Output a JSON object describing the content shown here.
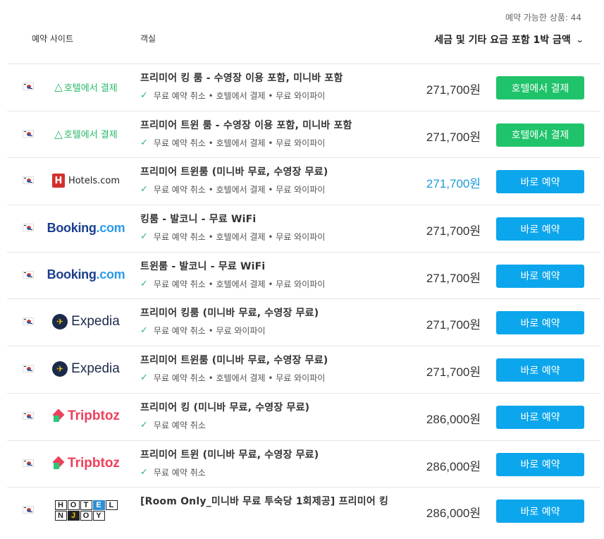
{
  "available_text": "예약 가능한 상품: 44",
  "header": {
    "site_col": "예약 사이트",
    "room_col": "객실",
    "price_col": "세금 및 기타 요금 포함 1박 금액",
    "sort_icon": "chevron-down-icon"
  },
  "colors": {
    "green_button": "#1fc36a",
    "blue_button": "#0ca6ec",
    "highlight_price": "#1e9bd7"
  },
  "offers": [
    {
      "provider": "호텔에서 결제",
      "logo": "hotel-pay",
      "title": "프리미어 킹 룸 - 수영장 이용 포함, 미니바 포함",
      "features": "무료 예약 취소 • 호텔에서 결제 • 무료 와이파이",
      "price": "271,700원",
      "button": "호텔에서 결제",
      "button_style": "green",
      "price_highlight": false
    },
    {
      "provider": "호텔에서 결제",
      "logo": "hotel-pay",
      "title": "프리미어 트윈 룸 - 수영장 이용 포함, 미니바 포함",
      "features": "무료 예약 취소 • 호텔에서 결제 • 무료 와이파이",
      "price": "271,700원",
      "button": "호텔에서 결제",
      "button_style": "green",
      "price_highlight": false
    },
    {
      "provider": "Hotels.com",
      "logo": "hotelscom",
      "title": "프리미어 트윈룸 (미니바 무료, 수영장 무료)",
      "features": "무료 예약 취소 • 호텔에서 결제 • 무료 와이파이",
      "price": "271,700원",
      "button": "바로 예약",
      "button_style": "blue",
      "price_highlight": true
    },
    {
      "provider": "Booking",
      "provider_suffix": ".com",
      "logo": "booking",
      "title": "킹룸 - 발코니 - 무료 WiFi",
      "features": "무료 예약 취소 • 호텔에서 결제 • 무료 와이파이",
      "price": "271,700원",
      "button": "바로 예약",
      "button_style": "blue",
      "price_highlight": false
    },
    {
      "provider": "Booking",
      "provider_suffix": ".com",
      "logo": "booking",
      "title": "트윈룸 - 발코니 - 무료 WiFi",
      "features": "무료 예약 취소 • 호텔에서 결제 • 무료 와이파이",
      "price": "271,700원",
      "button": "바로 예약",
      "button_style": "blue",
      "price_highlight": false
    },
    {
      "provider": "Expedia",
      "logo": "expedia",
      "title": "프리미어 킹룸 (미니바 무료, 수영장 무료)",
      "features": "무료 예약 취소 • 무료 와이파이",
      "price": "271,700원",
      "button": "바로 예약",
      "button_style": "blue",
      "price_highlight": false
    },
    {
      "provider": "Expedia",
      "logo": "expedia",
      "title": "프리미어 트윈룸 (미니바 무료, 수영장 무료)",
      "features": "무료 예약 취소 • 호텔에서 결제 • 무료 와이파이",
      "price": "271,700원",
      "button": "바로 예약",
      "button_style": "blue",
      "price_highlight": false
    },
    {
      "provider": "Tripbtoz",
      "logo": "tripbtoz",
      "title": "프리미어 킹 (미니바 무료, 수영장 무료)",
      "features": "무료 예약 취소",
      "price": "286,000원",
      "button": "바로 예약",
      "button_style": "blue",
      "price_highlight": false
    },
    {
      "provider": "Tripbtoz",
      "logo": "tripbtoz",
      "title": "프리미어 트윈 (미니바 무료, 수영장 무료)",
      "features": "무료 예약 취소",
      "price": "286,000원",
      "button": "바로 예약",
      "button_style": "blue",
      "price_highlight": false
    },
    {
      "provider": "HOTELNJOY",
      "logo": "hotelnjoy",
      "title": "[Room Only_미니바 무료 투숙당 1회제공] 프리미어 킹",
      "features": "",
      "price": "286,000원",
      "button": "바로 예약",
      "button_style": "blue",
      "price_highlight": false
    }
  ]
}
